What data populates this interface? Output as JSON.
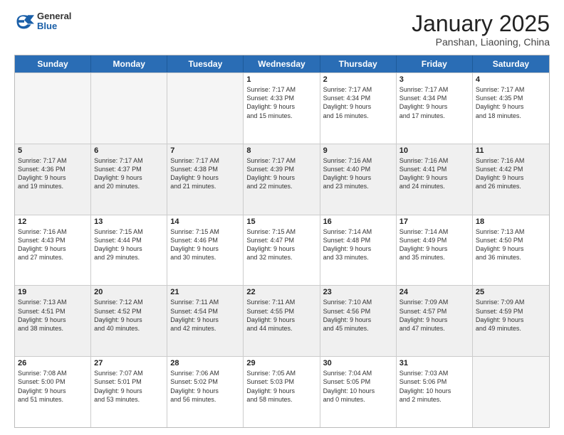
{
  "header": {
    "logo_general": "General",
    "logo_blue": "Blue",
    "month": "January 2025",
    "location": "Panshan, Liaoning, China"
  },
  "weekdays": [
    "Sunday",
    "Monday",
    "Tuesday",
    "Wednesday",
    "Thursday",
    "Friday",
    "Saturday"
  ],
  "rows": [
    [
      {
        "day": "",
        "lines": [],
        "empty": true
      },
      {
        "day": "",
        "lines": [],
        "empty": true
      },
      {
        "day": "",
        "lines": [],
        "empty": true
      },
      {
        "day": "1",
        "lines": [
          "Sunrise: 7:17 AM",
          "Sunset: 4:33 PM",
          "Daylight: 9 hours",
          "and 15 minutes."
        ]
      },
      {
        "day": "2",
        "lines": [
          "Sunrise: 7:17 AM",
          "Sunset: 4:34 PM",
          "Daylight: 9 hours",
          "and 16 minutes."
        ]
      },
      {
        "day": "3",
        "lines": [
          "Sunrise: 7:17 AM",
          "Sunset: 4:34 PM",
          "Daylight: 9 hours",
          "and 17 minutes."
        ]
      },
      {
        "day": "4",
        "lines": [
          "Sunrise: 7:17 AM",
          "Sunset: 4:35 PM",
          "Daylight: 9 hours",
          "and 18 minutes."
        ]
      }
    ],
    [
      {
        "day": "5",
        "lines": [
          "Sunrise: 7:17 AM",
          "Sunset: 4:36 PM",
          "Daylight: 9 hours",
          "and 19 minutes."
        ],
        "shaded": true
      },
      {
        "day": "6",
        "lines": [
          "Sunrise: 7:17 AM",
          "Sunset: 4:37 PM",
          "Daylight: 9 hours",
          "and 20 minutes."
        ],
        "shaded": true
      },
      {
        "day": "7",
        "lines": [
          "Sunrise: 7:17 AM",
          "Sunset: 4:38 PM",
          "Daylight: 9 hours",
          "and 21 minutes."
        ],
        "shaded": true
      },
      {
        "day": "8",
        "lines": [
          "Sunrise: 7:17 AM",
          "Sunset: 4:39 PM",
          "Daylight: 9 hours",
          "and 22 minutes."
        ],
        "shaded": true
      },
      {
        "day": "9",
        "lines": [
          "Sunrise: 7:16 AM",
          "Sunset: 4:40 PM",
          "Daylight: 9 hours",
          "and 23 minutes."
        ],
        "shaded": true
      },
      {
        "day": "10",
        "lines": [
          "Sunrise: 7:16 AM",
          "Sunset: 4:41 PM",
          "Daylight: 9 hours",
          "and 24 minutes."
        ],
        "shaded": true
      },
      {
        "day": "11",
        "lines": [
          "Sunrise: 7:16 AM",
          "Sunset: 4:42 PM",
          "Daylight: 9 hours",
          "and 26 minutes."
        ],
        "shaded": true
      }
    ],
    [
      {
        "day": "12",
        "lines": [
          "Sunrise: 7:16 AM",
          "Sunset: 4:43 PM",
          "Daylight: 9 hours",
          "and 27 minutes."
        ]
      },
      {
        "day": "13",
        "lines": [
          "Sunrise: 7:15 AM",
          "Sunset: 4:44 PM",
          "Daylight: 9 hours",
          "and 29 minutes."
        ]
      },
      {
        "day": "14",
        "lines": [
          "Sunrise: 7:15 AM",
          "Sunset: 4:46 PM",
          "Daylight: 9 hours",
          "and 30 minutes."
        ]
      },
      {
        "day": "15",
        "lines": [
          "Sunrise: 7:15 AM",
          "Sunset: 4:47 PM",
          "Daylight: 9 hours",
          "and 32 minutes."
        ]
      },
      {
        "day": "16",
        "lines": [
          "Sunrise: 7:14 AM",
          "Sunset: 4:48 PM",
          "Daylight: 9 hours",
          "and 33 minutes."
        ]
      },
      {
        "day": "17",
        "lines": [
          "Sunrise: 7:14 AM",
          "Sunset: 4:49 PM",
          "Daylight: 9 hours",
          "and 35 minutes."
        ]
      },
      {
        "day": "18",
        "lines": [
          "Sunrise: 7:13 AM",
          "Sunset: 4:50 PM",
          "Daylight: 9 hours",
          "and 36 minutes."
        ]
      }
    ],
    [
      {
        "day": "19",
        "lines": [
          "Sunrise: 7:13 AM",
          "Sunset: 4:51 PM",
          "Daylight: 9 hours",
          "and 38 minutes."
        ],
        "shaded": true
      },
      {
        "day": "20",
        "lines": [
          "Sunrise: 7:12 AM",
          "Sunset: 4:52 PM",
          "Daylight: 9 hours",
          "and 40 minutes."
        ],
        "shaded": true
      },
      {
        "day": "21",
        "lines": [
          "Sunrise: 7:11 AM",
          "Sunset: 4:54 PM",
          "Daylight: 9 hours",
          "and 42 minutes."
        ],
        "shaded": true
      },
      {
        "day": "22",
        "lines": [
          "Sunrise: 7:11 AM",
          "Sunset: 4:55 PM",
          "Daylight: 9 hours",
          "and 44 minutes."
        ],
        "shaded": true
      },
      {
        "day": "23",
        "lines": [
          "Sunrise: 7:10 AM",
          "Sunset: 4:56 PM",
          "Daylight: 9 hours",
          "and 45 minutes."
        ],
        "shaded": true
      },
      {
        "day": "24",
        "lines": [
          "Sunrise: 7:09 AM",
          "Sunset: 4:57 PM",
          "Daylight: 9 hours",
          "and 47 minutes."
        ],
        "shaded": true
      },
      {
        "day": "25",
        "lines": [
          "Sunrise: 7:09 AM",
          "Sunset: 4:59 PM",
          "Daylight: 9 hours",
          "and 49 minutes."
        ],
        "shaded": true
      }
    ],
    [
      {
        "day": "26",
        "lines": [
          "Sunrise: 7:08 AM",
          "Sunset: 5:00 PM",
          "Daylight: 9 hours",
          "and 51 minutes."
        ]
      },
      {
        "day": "27",
        "lines": [
          "Sunrise: 7:07 AM",
          "Sunset: 5:01 PM",
          "Daylight: 9 hours",
          "and 53 minutes."
        ]
      },
      {
        "day": "28",
        "lines": [
          "Sunrise: 7:06 AM",
          "Sunset: 5:02 PM",
          "Daylight: 9 hours",
          "and 56 minutes."
        ]
      },
      {
        "day": "29",
        "lines": [
          "Sunrise: 7:05 AM",
          "Sunset: 5:03 PM",
          "Daylight: 9 hours",
          "and 58 minutes."
        ]
      },
      {
        "day": "30",
        "lines": [
          "Sunrise: 7:04 AM",
          "Sunset: 5:05 PM",
          "Daylight: 10 hours",
          "and 0 minutes."
        ]
      },
      {
        "day": "31",
        "lines": [
          "Sunrise: 7:03 AM",
          "Sunset: 5:06 PM",
          "Daylight: 10 hours",
          "and 2 minutes."
        ]
      },
      {
        "day": "",
        "lines": [],
        "empty": true
      }
    ]
  ]
}
